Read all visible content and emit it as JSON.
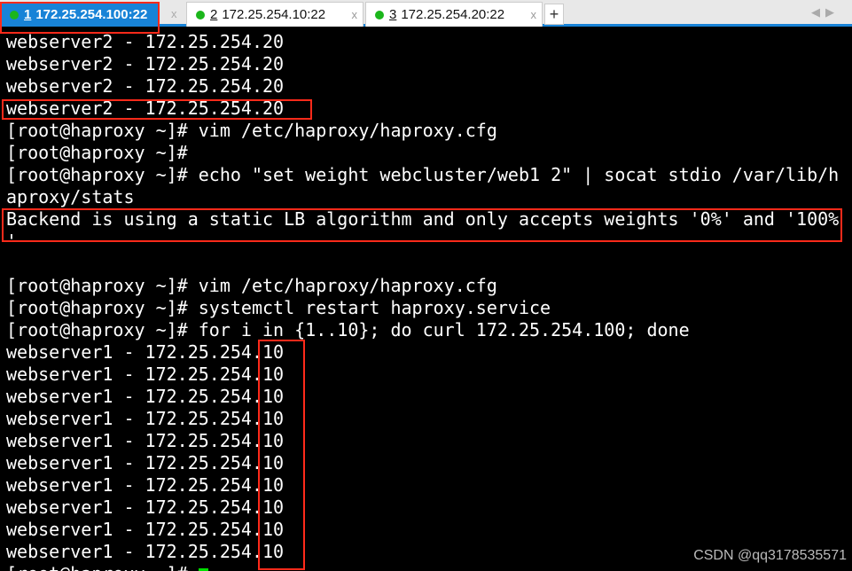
{
  "tabs": [
    {
      "num": "1",
      "label": "172.25.254.100:22",
      "active": true
    },
    {
      "num": "2",
      "label": "172.25.254.10:22",
      "active": false
    },
    {
      "num": "3",
      "label": "172.25.254.20:22",
      "active": false
    }
  ],
  "add_tab": "+",
  "close_glyph": "x",
  "nav_arrows": "◀▶",
  "terminal": {
    "lines": [
      "webserver2 - 172.25.254.20",
      "webserver2 - 172.25.254.20",
      "webserver2 - 172.25.254.20",
      "webserver2 - 172.25.254.20",
      "[root@haproxy ~]# vim /etc/haproxy/haproxy.cfg",
      "[root@haproxy ~]#",
      "[root@haproxy ~]# echo \"set weight webcluster/web1 2\" | socat stdio /var/lib/h",
      "aproxy/stats",
      "Backend is using a static LB algorithm and only accepts weights '0%' and '100%",
      "'",
      "",
      "[root@haproxy ~]# vim /etc/haproxy/haproxy.cfg",
      "[root@haproxy ~]# systemctl restart haproxy.service",
      "[root@haproxy ~]# for i in {1..10}; do curl 172.25.254.100; done",
      "webserver1 - 172.25.254.10",
      "webserver1 - 172.25.254.10",
      "webserver1 - 172.25.254.10",
      "webserver1 - 172.25.254.10",
      "webserver1 - 172.25.254.10",
      "webserver1 - 172.25.254.10",
      "webserver1 - 172.25.254.10",
      "webserver1 - 172.25.254.10",
      "webserver1 - 172.25.254.10",
      "webserver1 - 172.25.254.10",
      "[root@haproxy ~]# "
    ]
  },
  "watermark": "CSDN @qq3178535571",
  "colors": {
    "accent": "#1883d7",
    "highlight": "#ff2a1a",
    "cursor": "#00e000",
    "status_dot": "#1bb61b"
  }
}
